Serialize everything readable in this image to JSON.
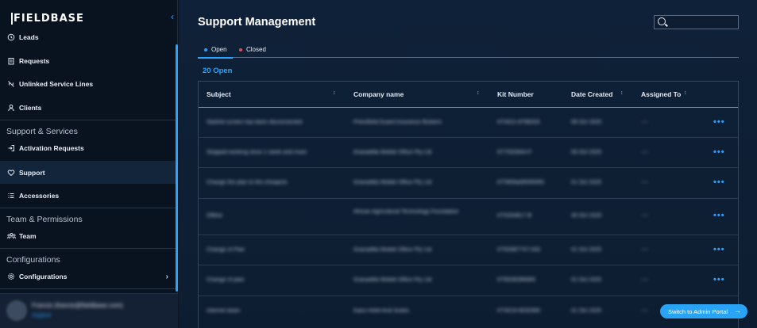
{
  "app": {
    "logo": "FIELDBASE",
    "collapse_icon": "chevron-left-icon"
  },
  "sidebar": {
    "items_top": [
      {
        "label": "Leads",
        "icon": "history-icon"
      },
      {
        "label": "Requests",
        "icon": "clipboard-icon"
      },
      {
        "label": "Unlinked Service Lines",
        "icon": "unlink-icon"
      },
      {
        "label": "Clients",
        "icon": "person-icon"
      }
    ],
    "section_support": "Support & Services",
    "items_support": [
      {
        "label": "Activation Requests",
        "icon": "login-arrow-icon"
      },
      {
        "label": "Support",
        "icon": "heart-icon",
        "active": true
      },
      {
        "label": "Accessories",
        "icon": "list-icon"
      }
    ],
    "section_team": "Team & Permissions",
    "items_team": [
      {
        "label": "Team",
        "icon": "team-icon"
      }
    ],
    "section_config": "Configurations",
    "items_config": [
      {
        "label": "Configurations",
        "icon": "gear-icon"
      }
    ],
    "user": {
      "name": "Francis (francis@fieldbase.com)",
      "role": "Support"
    }
  },
  "main": {
    "title": "Support Management",
    "search": {
      "placeholder": ""
    },
    "tabs": [
      {
        "label": "Open",
        "dot_color": "#2aa2ff"
      },
      {
        "label": "Closed",
        "dot_color": "#e0504e"
      }
    ],
    "count_label": "20 Open",
    "table": {
      "columns": [
        "Subject",
        "Company name",
        "Kit Number",
        "Date Created",
        "Assigned To"
      ],
      "rows": [
        {
          "subject": "Starlink screen has been disconnected",
          "company": "Priestfield Guard Insurance Brokers",
          "kit": "KT4011-8798263",
          "date": "06 Oct 2025",
          "assigned": "----"
        },
        {
          "subject": "Stopped working since 1 week and more",
          "company": "Granadilla Mobile Office Pty Ltd",
          "kit": "KT7532844-P",
          "date": "06 Oct 2025",
          "assigned": "----"
        },
        {
          "subject": "Change the plan to the cheapest",
          "company": "Granadilla Mobile Office Pty Ltd",
          "kit": "KT3656a0R0R0R0",
          "date": "01 Oct 2025",
          "assigned": "----"
        },
        {
          "subject": "Offline",
          "company": "African Agricultural Technology Foundation",
          "kit": "KT5204817-B",
          "date": "30 Oct 2025",
          "assigned": "----"
        },
        {
          "subject": "Change of Plan",
          "company": "Granadilla Mobile Office Pty Ltd",
          "kit": "KT82687747-043",
          "date": "01 Oct 2025",
          "assigned": "----"
        },
        {
          "subject": "Change of plan",
          "company": "Granadilla Mobile Office Pty Ltd",
          "kit": "KT8039396869",
          "date": "01 Oct 2025",
          "assigned": "----"
        },
        {
          "subject": "Internet down",
          "company": "Kairo Hotel And Suites",
          "kit": "KT4019-9032990",
          "date": "01 Oct 2025",
          "assigned": "----"
        }
      ],
      "actions_label": "•••"
    },
    "switch_button": "Switch to Admin Portal"
  }
}
